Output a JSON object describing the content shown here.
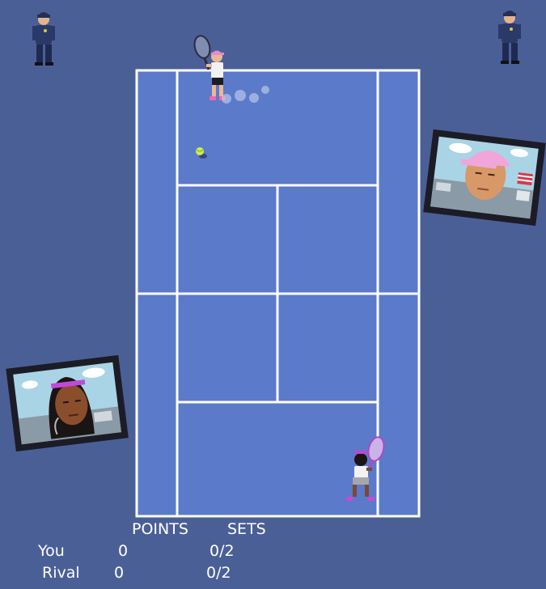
{
  "scoreboard": {
    "points_header": "POINTS",
    "sets_header": "SETS",
    "rows": [
      {
        "label": "You",
        "points": "0",
        "sets": "0/2"
      },
      {
        "label": "Rival",
        "points": "0",
        "sets": "0/2"
      }
    ]
  },
  "colors": {
    "background": "#4b5f97",
    "court": "#5b7ac9",
    "lines": "#ffffff",
    "ball": "#c8f04a"
  },
  "icons": {
    "guard_left": "security-guard-icon",
    "guard_right": "security-guard-icon",
    "rival_player": "tennis-player-pink-cap",
    "you_player": "tennis-player-purple-headband",
    "ball": "tennis-ball-icon",
    "screen_right": "jumbotron-rival-face",
    "screen_left": "jumbotron-player-face"
  }
}
